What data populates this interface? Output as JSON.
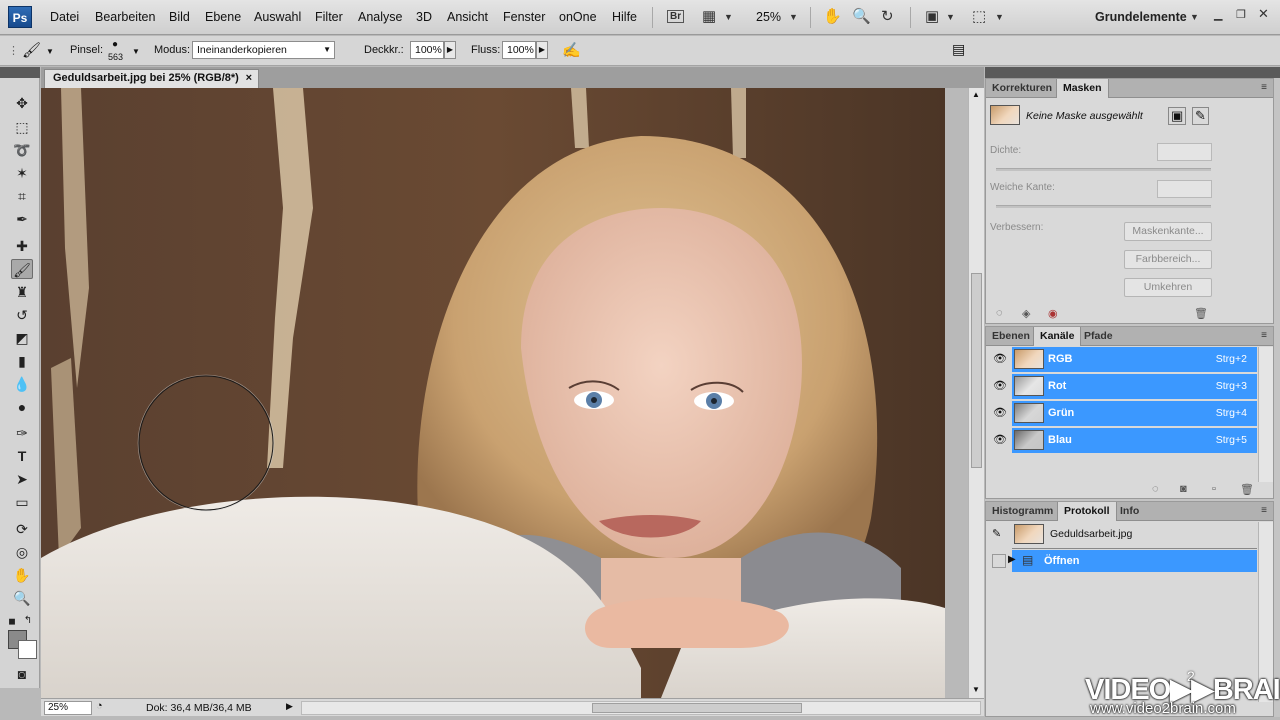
{
  "app": {
    "logo": "Ps",
    "menus": [
      "Datei",
      "Bearbeiten",
      "Bild",
      "Ebene",
      "Auswahl",
      "Filter",
      "Analyse",
      "3D",
      "Ansicht",
      "Fenster",
      "onOne",
      "Hilfe"
    ],
    "bridge_label": "Br",
    "zoom": "25%",
    "workspace": "Grundelemente"
  },
  "options": {
    "brush_label": "Pinsel:",
    "brush_size": "563",
    "mode_label": "Modus:",
    "mode_value": "Ineinanderkopieren",
    "opacity_label": "Deckkr.:",
    "opacity_value": "100%",
    "flow_label": "Fluss:",
    "flow_value": "100%"
  },
  "document": {
    "tab_title": "Geduldsarbeit.jpg bei 25% (RGB/8*)",
    "close": "×",
    "zoom_field": "25%",
    "doc_info": "Dok: 36,4 MB/36,4 MB"
  },
  "masks_panel": {
    "tabs": [
      "Korrekturen",
      "Masken"
    ],
    "no_mask": "Keine Maske ausgewählt",
    "density_label": "Dichte:",
    "feather_label": "Weiche Kante:",
    "refine_label": "Verbessern:",
    "buttons": [
      "Maskenkante...",
      "Farbbereich...",
      "Umkehren"
    ]
  },
  "channels_panel": {
    "tabs": [
      "Ebenen",
      "Kanäle",
      "Pfade"
    ],
    "channels": [
      {
        "name": "RGB",
        "shortcut": "Strg+2"
      },
      {
        "name": "Rot",
        "shortcut": "Strg+3"
      },
      {
        "name": "Grün",
        "shortcut": "Strg+4"
      },
      {
        "name": "Blau",
        "shortcut": "Strg+5"
      }
    ]
  },
  "history_panel": {
    "tabs": [
      "Histogramm",
      "Protokoll",
      "Info"
    ],
    "snapshot": "Geduldsarbeit.jpg",
    "steps": [
      "Öffnen"
    ]
  },
  "watermark": {
    "brand": "VIDEO▶▶BRAIN",
    "sup": "2",
    "url": "www.video2brain.com"
  },
  "colors": {
    "selection": "#3b98ff",
    "ui_bg": "#d9d9d9"
  }
}
